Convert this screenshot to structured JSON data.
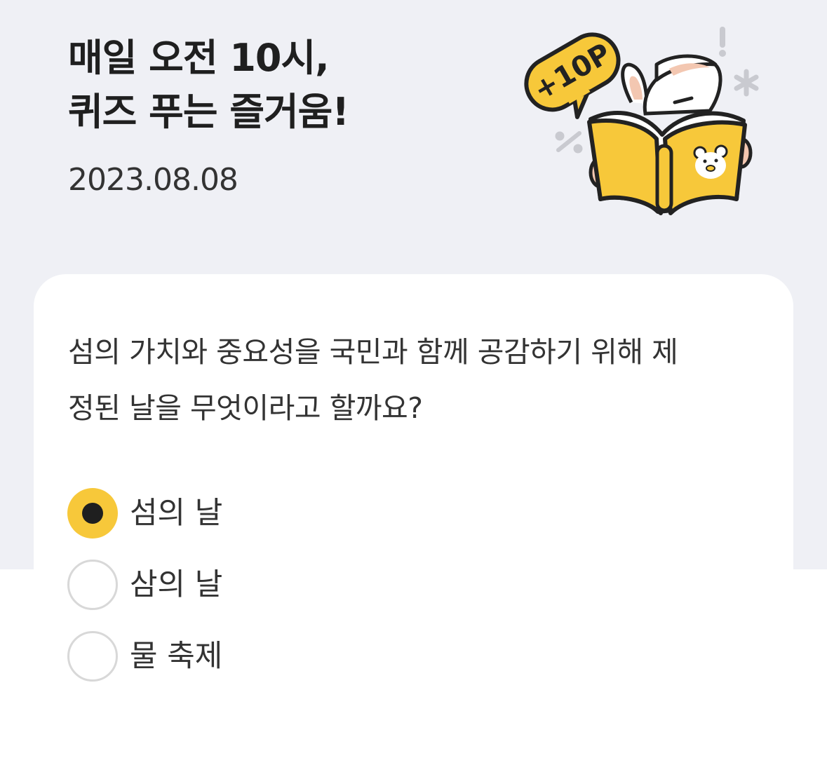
{
  "header": {
    "title_line1": "매일 오전 10시,",
    "title_line2": "퀴즈 푸는 즐거움!",
    "date": "2023.08.08"
  },
  "illustration": {
    "badge_text": "+10P",
    "icon": "rabbit-reading-book-icon"
  },
  "quiz": {
    "question_line1": "섬의 가치와 중요성을 국민과 함께 공감하기 위해 제",
    "question_line2": "정된 날을 무엇이라고 할까요?",
    "options": [
      {
        "label": "섬의 날",
        "selected": true
      },
      {
        "label": "삼의 날",
        "selected": false
      },
      {
        "label": "물 축제",
        "selected": false
      }
    ]
  },
  "colors": {
    "background": "#eff0f5",
    "accent_yellow": "#f7c83a",
    "card": "#ffffff",
    "text": "#222222"
  }
}
